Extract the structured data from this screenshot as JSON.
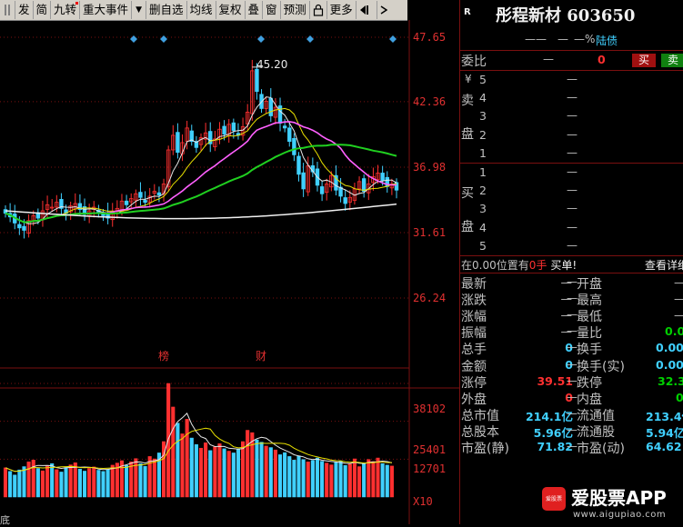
{
  "toolbar": {
    "items": [
      "发",
      "简",
      "九转",
      "重大事件",
      "▼",
      "删自选",
      "均线",
      "复权",
      "叠",
      "窗",
      "预测",
      "",
      "更多",
      ""
    ]
  },
  "chart": {
    "price_axis": [
      "47.65",
      "42.36",
      "36.98",
      "31.61",
      "26.24"
    ],
    "volume_axis": [
      "38102",
      "25401",
      "12701"
    ],
    "volume_unit": "X10",
    "high_marker": "45.20",
    "event_markers": [
      "榜",
      "财"
    ],
    "bottom_label": "底"
  },
  "chart_data": [
    {
      "type": "candlestick",
      "ylim": [
        26.24,
        47.65
      ],
      "annotation": "45.20",
      "series": [
        {
          "name": "close",
          "values": [
            33.2,
            32.9,
            32.4,
            32.0,
            31.8,
            32.6,
            33.0,
            32.8,
            33.4,
            33.9,
            33.7,
            34.1,
            33.6,
            33.2,
            33.8,
            34.0,
            33.5,
            33.1,
            33.4,
            33.7,
            33.2,
            33.0,
            32.8,
            33.3,
            33.6,
            34.2,
            33.9,
            34.4,
            34.8,
            34.5,
            34.1,
            34.6,
            35.0,
            34.7,
            35.6,
            38.4,
            39.6,
            38.2,
            39.0,
            40.2,
            39.1,
            38.6,
            39.4,
            39.8,
            38.9,
            39.3,
            40.1,
            39.7,
            40.5,
            40.0,
            39.6,
            40.3,
            41.5,
            44.9,
            43.2,
            41.8,
            42.4,
            41.2,
            41.9,
            40.6,
            40.2,
            39.1,
            38.0,
            36.4,
            35.2,
            37.1,
            36.6,
            35.5,
            34.8,
            35.6,
            36.3,
            35.1,
            34.6,
            34.0,
            34.5,
            35.2,
            35.8,
            35.0,
            35.6,
            36.2,
            36.5,
            35.9,
            35.4,
            35.6,
            35.1
          ]
        }
      ]
    },
    {
      "type": "bar",
      "ylim": [
        0,
        38102
      ],
      "series": [
        {
          "name": "volume",
          "values": [
            9800,
            8600,
            7400,
            9100,
            10200,
            11800,
            12400,
            9600,
            8800,
            10400,
            11200,
            9200,
            8400,
            9900,
            10800,
            11500,
            9400,
            8700,
            9600,
            10100,
            9000,
            8600,
            9200,
            10700,
            11400,
            12200,
            10600,
            11800,
            12900,
            11200,
            10300,
            13600,
            12800,
            14800,
            18600,
            38102,
            30200,
            24800,
            21200,
            26100,
            19800,
            17600,
            16400,
            18200,
            15600,
            16800,
            17900,
            16200,
            15400,
            14800,
            16100,
            18600,
            22400,
            21600,
            19200,
            18400,
            17100,
            16600,
            15800,
            14200,
            14900,
            13600,
            12400,
            13800,
            12600,
            11800,
            12300,
            13100,
            12000,
            11400,
            10800,
            11600,
            12100,
            10600,
            11100,
            12800,
            10200,
            11400,
            12600,
            11900,
            13100,
            11200,
            10700,
            10400
          ]
        }
      ]
    }
  ],
  "quote": {
    "code_badge": "R",
    "stock_name": "彤程新材 603650",
    "sub_dash1": "——",
    "sub_dash2": "—",
    "sub_pct": "—%",
    "sub_tag": "陆债",
    "weibi_label": "委比",
    "weibi_val": "—",
    "weibi_num": "0",
    "buy_btn": "买",
    "sell_btn": "卖",
    "yen": "¥",
    "sell_label_1": "卖",
    "sell_label_2": "盘",
    "buy_label_1": "买",
    "buy_label_2": "盘",
    "sell_levels": [
      "5",
      "4",
      "3",
      "2",
      "1"
    ],
    "buy_levels": [
      "1",
      "2",
      "3",
      "4",
      "5"
    ],
    "book_dash": "—",
    "pos_text_1": "在0.00位置有",
    "pos_text_2": "0手",
    "pos_text_3": "买单!",
    "detail_link": "查看详细",
    "rows": [
      {
        "l1": "最新",
        "v1": "—",
        "l2": "开盘",
        "v2": "—"
      },
      {
        "l1": "涨跌",
        "v1": "—",
        "l2": "最高",
        "v2": "—"
      },
      {
        "l1": "涨幅",
        "v1": "—",
        "l2": "最低",
        "v2": "—"
      },
      {
        "l1": "振幅",
        "v1": "—",
        "l2": "量比",
        "v2": "0.00"
      },
      {
        "l1": "总手",
        "v1": "0",
        "l2": "换手",
        "v2": "0.00%"
      },
      {
        "l1": "金额",
        "v1": "0",
        "l2": "换手(实)",
        "v2": "0.00%"
      },
      {
        "l1": "涨停",
        "v1": "39.51",
        "l2": "跌停",
        "v2": "32.33"
      },
      {
        "l1": "外盘",
        "v1": "0",
        "l2": "内盘",
        "v2": "0"
      },
      {
        "l1": "总市值",
        "v1": "214.1亿",
        "l2": "流通值",
        "v2": "213.4亿"
      },
      {
        "l1": "总股本",
        "v1": "5.96亿",
        "l2": "流通股",
        "v2": "5.94亿"
      },
      {
        "l1": "市盈(静)",
        "v1": "71.82",
        "l2": "市盈(动)",
        "v2": "64.62"
      }
    ]
  },
  "watermark": {
    "brand": "爱股票APP",
    "url": "www.aigupiao.com",
    "logo": "爱股票"
  },
  "colors": {
    "up": "#ff3030",
    "down": "#40d0ff",
    "ma_white": "#e8e8e8",
    "ma_yellow": "#e8e000",
    "ma_pink": "#ff60ff",
    "ma_green": "#20d020",
    "grid": "#7a1010"
  }
}
